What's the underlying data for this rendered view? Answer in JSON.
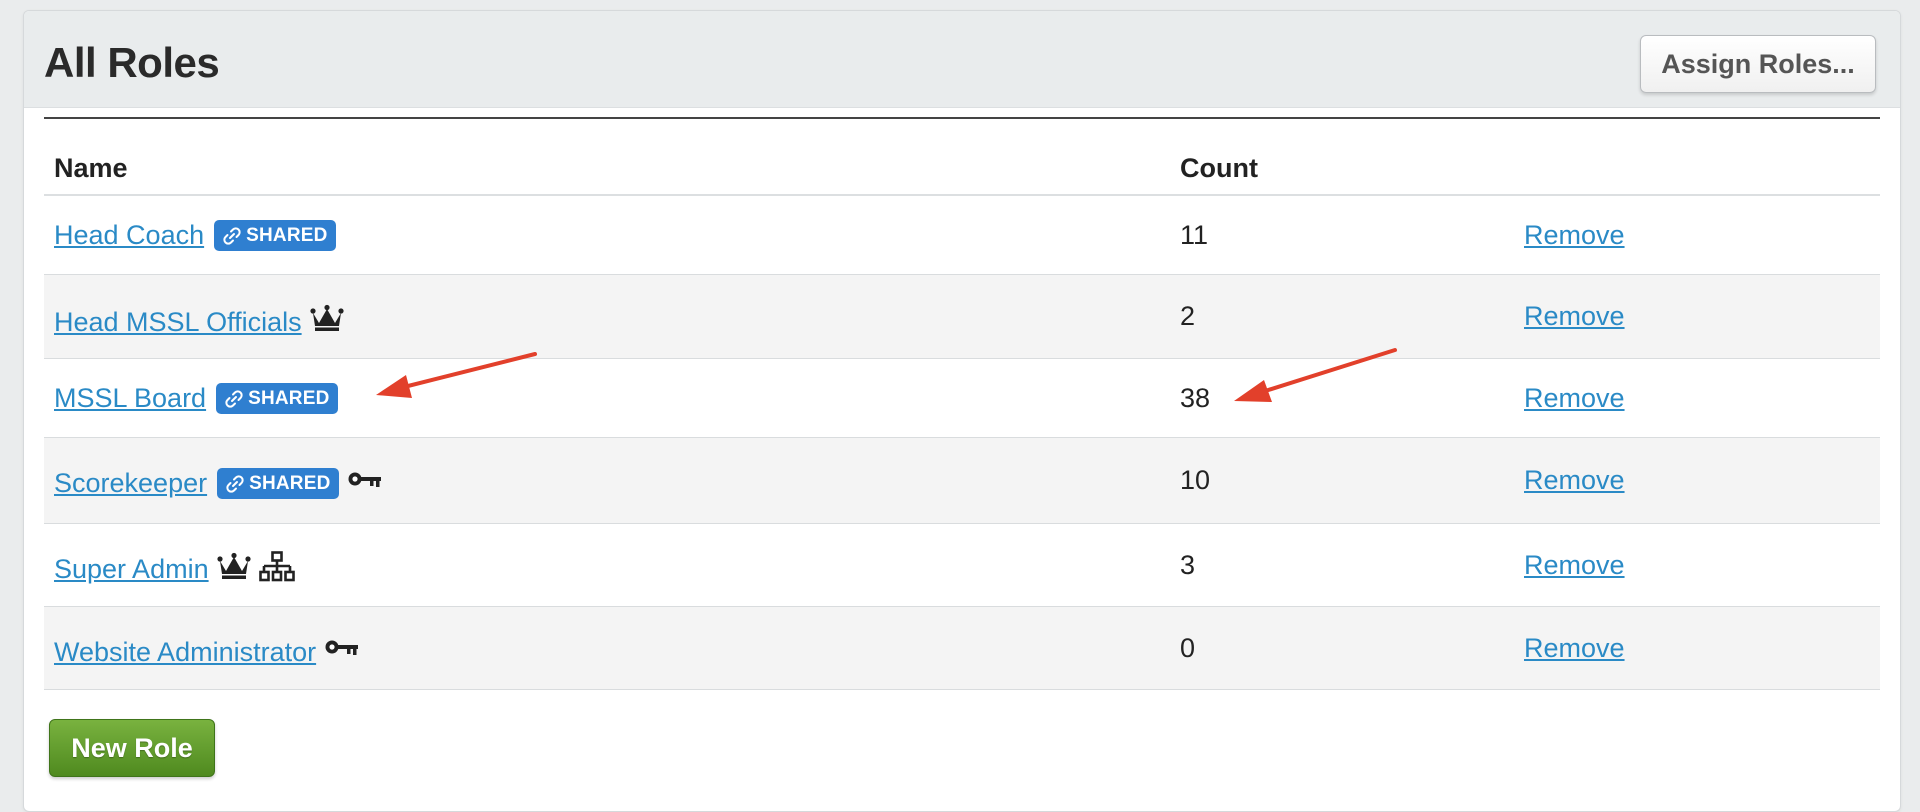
{
  "header": {
    "title": "All Roles",
    "assign_button": "Assign Roles..."
  },
  "table": {
    "columns": {
      "name": "Name",
      "count": "Count"
    },
    "rows": [
      {
        "name": "Head Coach",
        "badge": "SHARED",
        "icons": [],
        "count": "11",
        "action": "Remove"
      },
      {
        "name": "Head MSSL Officials",
        "badge": "",
        "icons": [
          "crown-icon"
        ],
        "count": "2",
        "action": "Remove"
      },
      {
        "name": "MSSL Board",
        "badge": "SHARED",
        "icons": [],
        "count": "38",
        "action": "Remove"
      },
      {
        "name": "Scorekeeper",
        "badge": "SHARED",
        "icons": [
          "key-icon"
        ],
        "count": "10",
        "action": "Remove"
      },
      {
        "name": "Super Admin",
        "badge": "",
        "icons": [
          "crown-icon",
          "org-chart-icon"
        ],
        "count": "3",
        "action": "Remove"
      },
      {
        "name": "Website Administrator",
        "badge": "",
        "icons": [
          "key-icon"
        ],
        "count": "0",
        "action": "Remove"
      }
    ]
  },
  "footer": {
    "new_role_button": "New Role"
  },
  "colors": {
    "link": "#2a8ac6",
    "badge": "#2f7fd0",
    "new_role_button": "#5e9a2b",
    "annotation_arrow": "#e2402b"
  }
}
